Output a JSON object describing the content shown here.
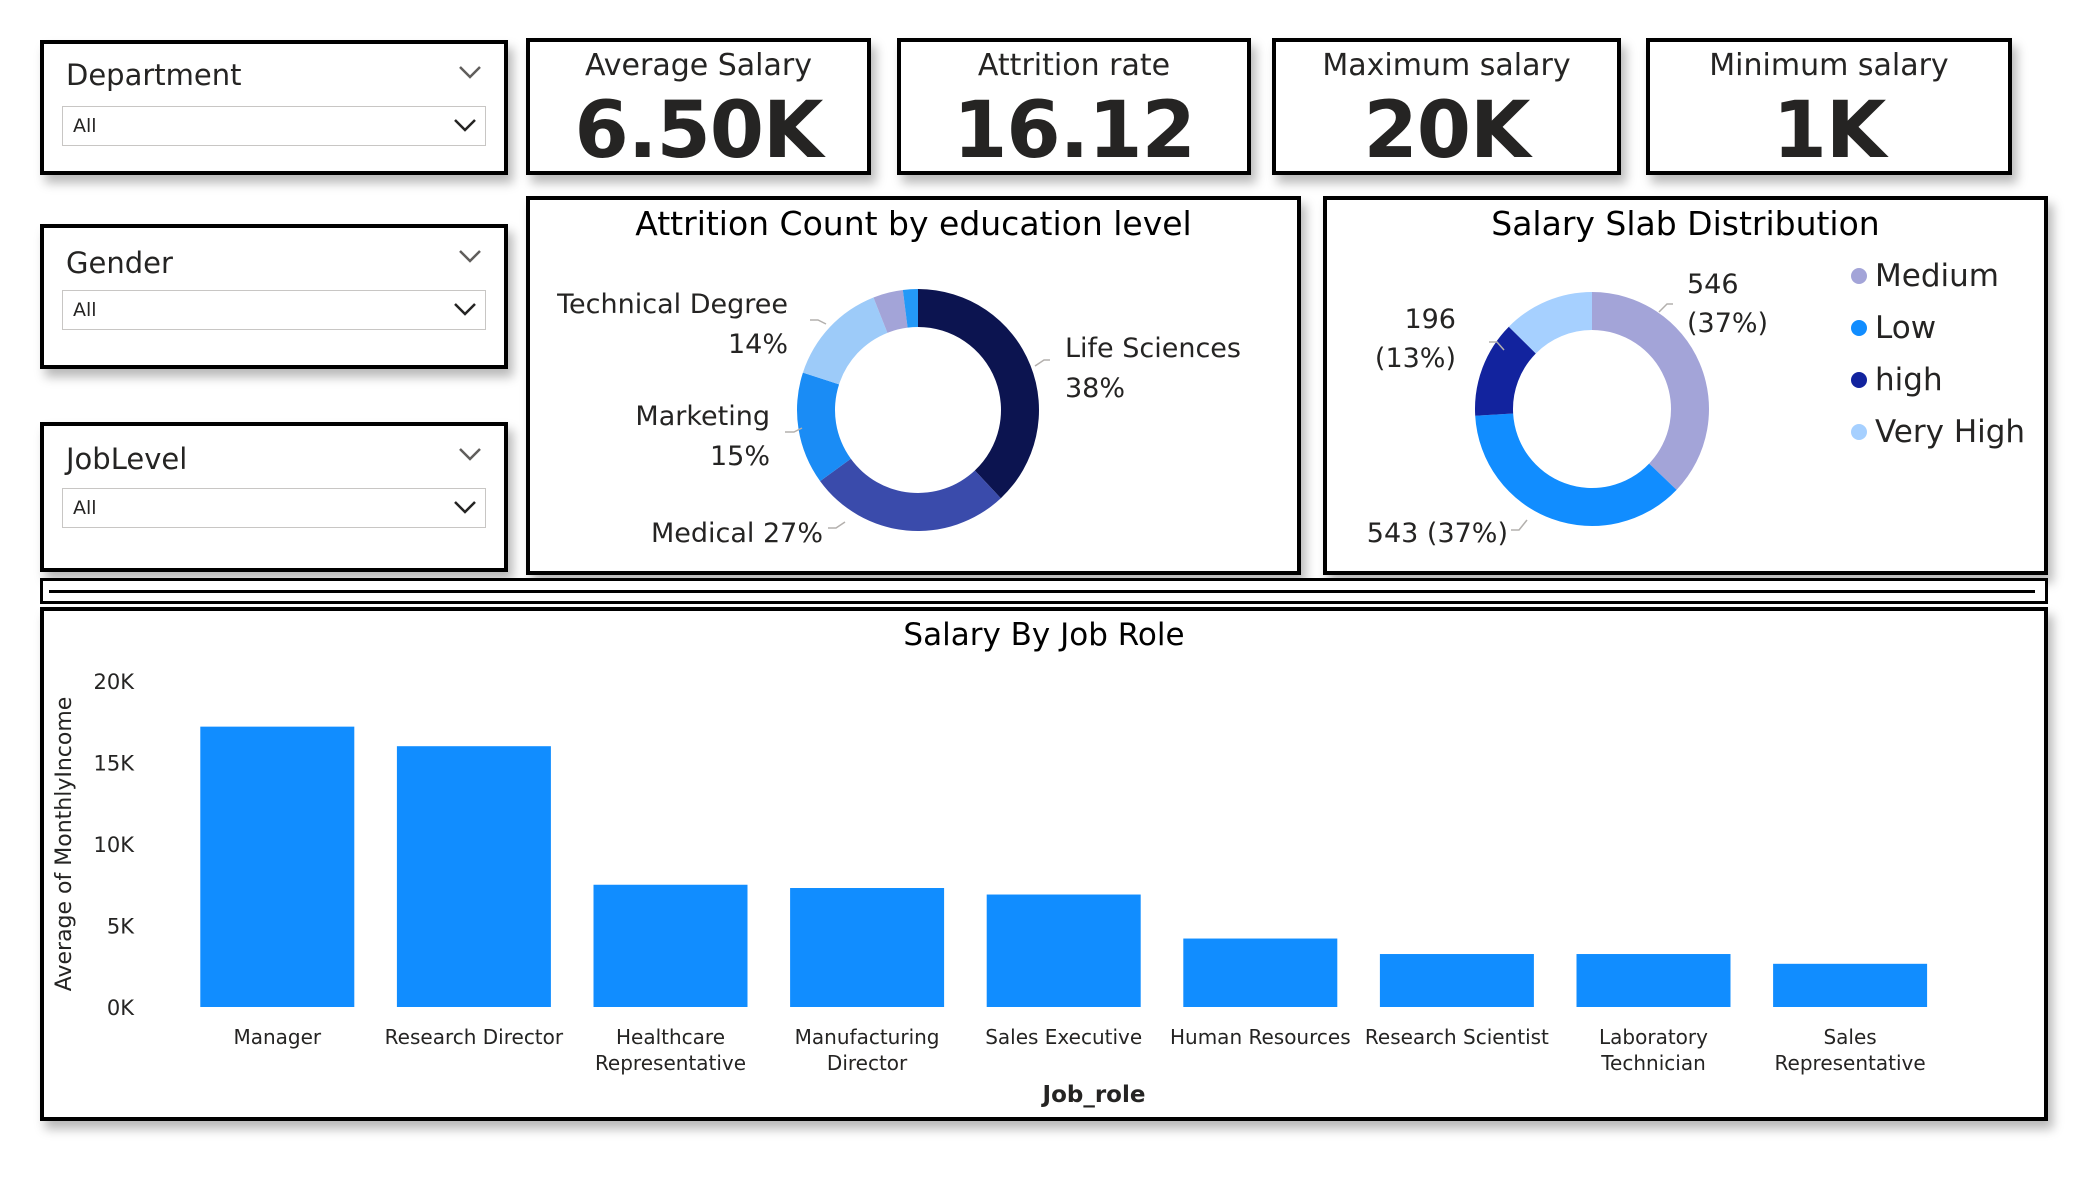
{
  "filters": [
    {
      "label": "Department",
      "value": "All"
    },
    {
      "label": "Gender",
      "value": "All"
    },
    {
      "label": "JobLevel",
      "value": "All"
    }
  ],
  "kpis": [
    {
      "title": "Average Salary",
      "value": "6.50K"
    },
    {
      "title": "Attrition rate",
      "value": "16.12"
    },
    {
      "title": "Maximum salary",
      "value": "20K"
    },
    {
      "title": "Minimum salary",
      "value": "1K"
    }
  ],
  "icons": {
    "dropdown": "chevron-down-icon"
  },
  "chart_data": [
    {
      "type": "pie",
      "title": "Attrition Count by education level",
      "labels": [
        "Life Sciences",
        "Medical",
        "Marketing",
        "Technical Degree",
        "",
        ""
      ],
      "percent_labels": [
        "38%",
        "27%",
        "15%",
        "14%",
        "",
        ""
      ],
      "values": [
        38,
        27,
        15,
        14,
        4,
        2
      ],
      "colors": [
        "#0c1450",
        "#3a4bab",
        "#1a8cf5",
        "#9dcbf9",
        "#a3a4d8",
        "#2499f7"
      ],
      "donut": true
    },
    {
      "type": "pie",
      "title": "Salary Slab Distribution",
      "labels": [
        "Medium",
        "Low",
        "high",
        "Very High"
      ],
      "values": [
        546,
        543,
        196,
        185
      ],
      "data_labels": [
        [
          "546",
          "(37%)"
        ],
        [
          "543 (37%)"
        ],
        [
          "196",
          "(13%)"
        ],
        []
      ],
      "colors": [
        "#a3a4d8",
        "#118dff",
        "#12239e",
        "#a6d0ff"
      ],
      "legend": "right",
      "donut": true
    },
    {
      "type": "bar",
      "title": "Salary By Job Role",
      "xlabel": "Job_role",
      "ylabel": "Average of MonthlyIncome",
      "categories": [
        [
          "Manager"
        ],
        [
          "Research Director"
        ],
        [
          "Healthcare",
          "Representative"
        ],
        [
          "Manufacturing",
          "Director"
        ],
        [
          "Sales Executive"
        ],
        [
          "Human Resources"
        ],
        [
          "Research Scientist"
        ],
        [
          "Laboratory",
          "Technician"
        ],
        [
          "Sales",
          "Representative"
        ]
      ],
      "values": [
        17200,
        16000,
        7500,
        7300,
        6900,
        4200,
        3250,
        3250,
        2650
      ],
      "ylim": [
        0,
        20000
      ],
      "yticks": [
        "0K",
        "5K",
        "10K",
        "15K",
        "20K"
      ],
      "bar_color": "#118dff",
      "grid": false
    }
  ]
}
